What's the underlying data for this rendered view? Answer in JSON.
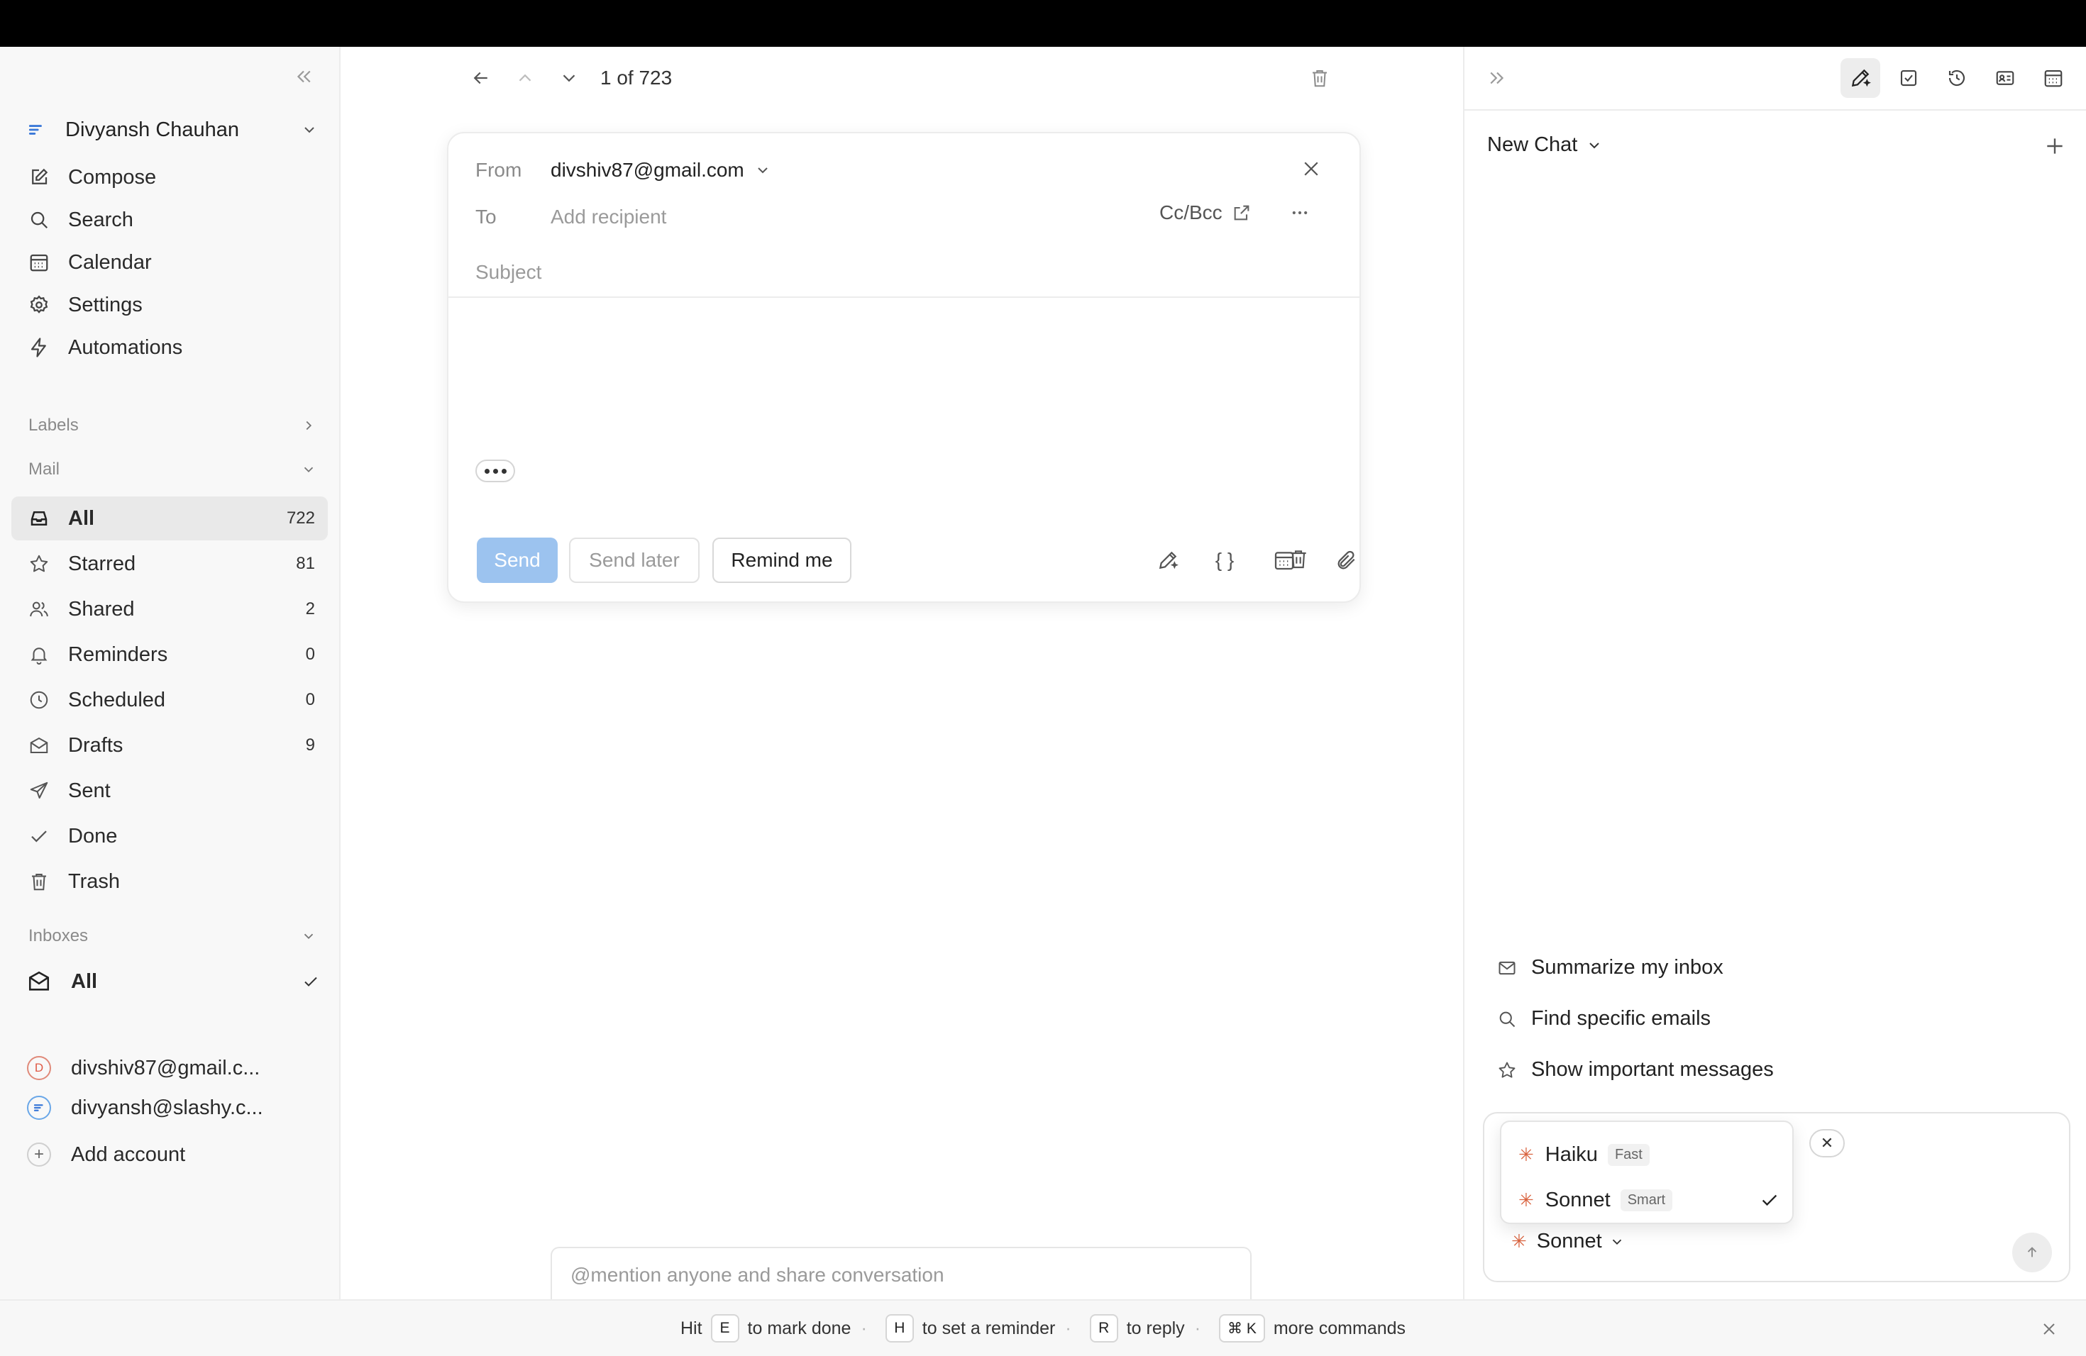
{
  "sidebar": {
    "account_name": "Divyansh Chauhan",
    "nav": [
      {
        "label": "Compose",
        "icon": "compose-icon"
      },
      {
        "label": "Search",
        "icon": "search-icon"
      },
      {
        "label": "Calendar",
        "icon": "calendar-icon"
      },
      {
        "label": "Settings",
        "icon": "gear-icon"
      },
      {
        "label": "Automations",
        "icon": "bolt-icon"
      }
    ],
    "labels_heading": "Labels",
    "mail_heading": "Mail",
    "mail": [
      {
        "label": "All",
        "count": "722",
        "icon": "inbox-icon"
      },
      {
        "label": "Starred",
        "count": "81",
        "icon": "star-icon"
      },
      {
        "label": "Shared",
        "count": "2",
        "icon": "users-icon"
      },
      {
        "label": "Reminders",
        "count": "0",
        "icon": "bell-icon"
      },
      {
        "label": "Scheduled",
        "count": "0",
        "icon": "clock-icon"
      },
      {
        "label": "Drafts",
        "count": "9",
        "icon": "envelope-icon"
      },
      {
        "label": "Sent",
        "count": "",
        "icon": "send-icon"
      },
      {
        "label": "Done",
        "count": "",
        "icon": "check-icon"
      },
      {
        "label": "Trash",
        "count": "",
        "icon": "trash-icon"
      }
    ],
    "inboxes_heading": "Inboxes",
    "inboxes": [
      {
        "label": "All"
      },
      {
        "label": "divshiv87@gmail.c...",
        "avatar": "D"
      },
      {
        "label": "divyansh@slashy.c..."
      }
    ],
    "add_account": "Add account"
  },
  "thread_nav": {
    "position": "1 of 723"
  },
  "compose": {
    "from_label": "From",
    "from_value": "divshiv87@gmail.com",
    "to_label": "To",
    "to_placeholder": "Add recipient",
    "cc_bcc": "Cc/Bcc",
    "subject_placeholder": "Subject",
    "send": "Send",
    "send_later": "Send later",
    "remind_me": "Remind me",
    "template_glyph": "{ }"
  },
  "mention_placeholder": "@mention anyone and share conversation",
  "chat": {
    "title": "New Chat",
    "suggestions": [
      {
        "label": "Summarize my inbox",
        "icon": "envelope-icon"
      },
      {
        "label": "Find specific emails",
        "icon": "search-icon"
      },
      {
        "label": "Show important messages",
        "icon": "star-icon"
      }
    ],
    "chip_close": "✕",
    "model_selected": "Sonnet",
    "models": [
      {
        "name": "Haiku",
        "tag": "Fast",
        "selected": false
      },
      {
        "name": "Sonnet",
        "tag": "Smart",
        "selected": true
      }
    ]
  },
  "hints": {
    "hit": "Hit",
    "k1": "E",
    "t1": "to mark done",
    "k2": "H",
    "t2": "to set a reminder",
    "k3": "R",
    "t3": "to reply",
    "k4": "⌘ K",
    "t4": "more commands",
    "sep": "·"
  },
  "colors": {
    "send_button": "#9cc3ef",
    "model_star": "#d9633f",
    "active_row": "#e9e9e9"
  }
}
